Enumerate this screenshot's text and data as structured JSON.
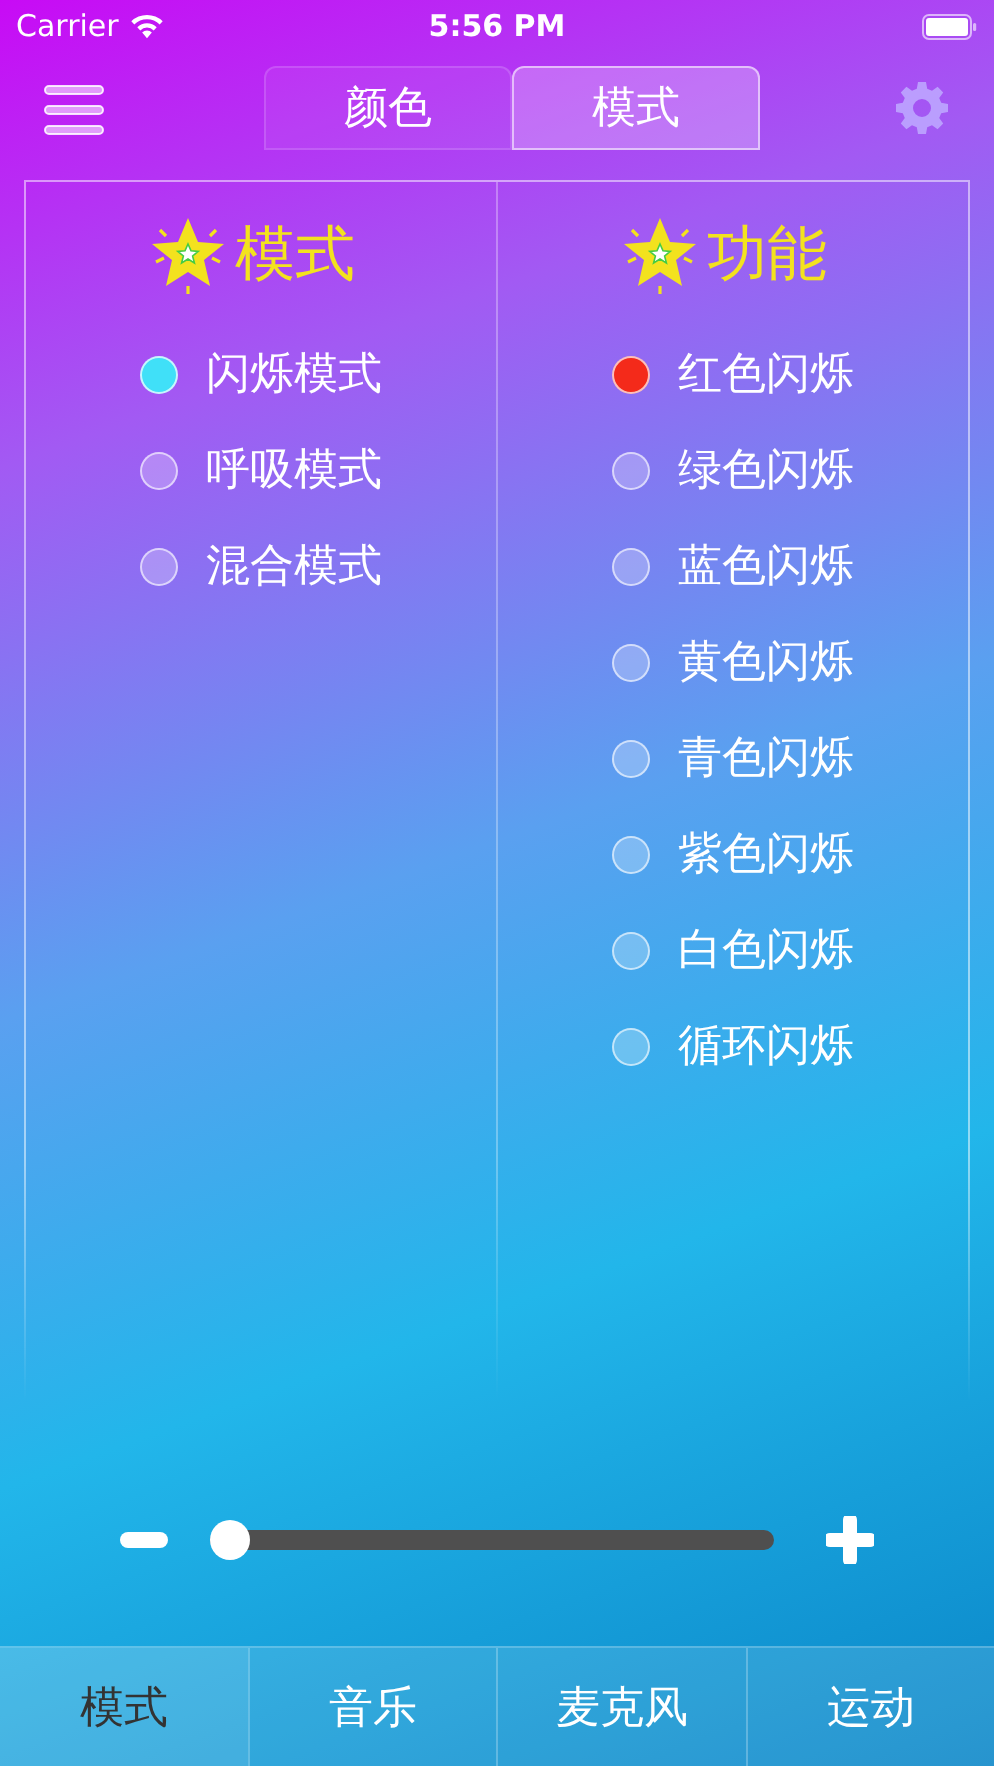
{
  "status_bar": {
    "carrier": "Carrier",
    "time": "5:56 PM"
  },
  "segments": [
    {
      "label": "颜色",
      "selected": false
    },
    {
      "label": "模式",
      "selected": true
    }
  ],
  "columns": [
    {
      "title": "模式",
      "options": [
        {
          "label": "闪烁模式",
          "selected": true,
          "color": "#40e0f8"
        },
        {
          "label": "呼吸模式",
          "selected": false
        },
        {
          "label": "混合模式",
          "selected": false
        }
      ]
    },
    {
      "title": "功能",
      "options": [
        {
          "label": "红色闪烁",
          "selected": true,
          "color": "#f42a1a"
        },
        {
          "label": "绿色闪烁",
          "selected": false
        },
        {
          "label": "蓝色闪烁",
          "selected": false
        },
        {
          "label": "黄色闪烁",
          "selected": false
        },
        {
          "label": "青色闪烁",
          "selected": false
        },
        {
          "label": "紫色闪烁",
          "selected": false
        },
        {
          "label": "白色闪烁",
          "selected": false
        },
        {
          "label": "循环闪烁",
          "selected": false
        }
      ]
    }
  ],
  "slider": {
    "level": 0.0
  },
  "tab_bar": [
    {
      "label": "模式",
      "selected": true
    },
    {
      "label": "音乐",
      "selected": false
    },
    {
      "label": "麦克风",
      "selected": false
    },
    {
      "label": "运动",
      "selected": false
    }
  ]
}
